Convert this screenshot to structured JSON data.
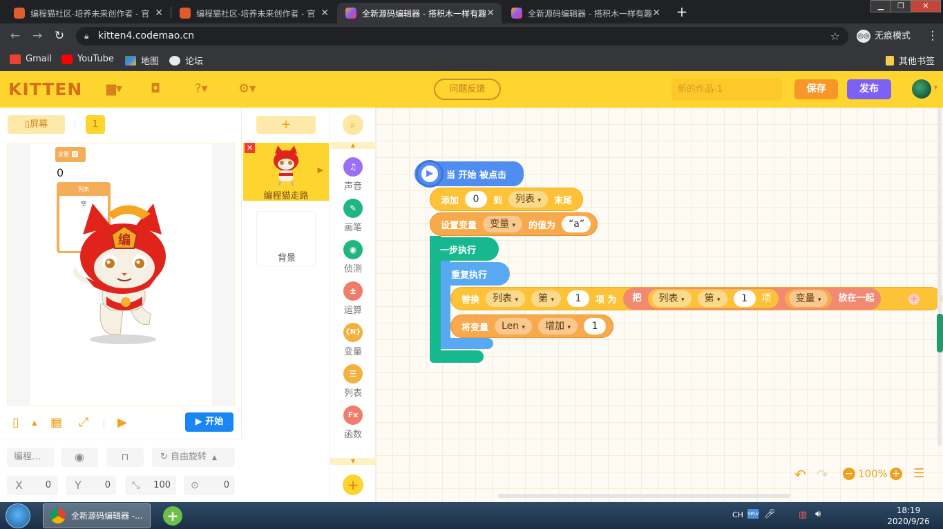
{
  "browser": {
    "tabs": [
      {
        "title": "编程猫社区-培养未来创作者 - 官",
        "active": false
      },
      {
        "title": "编程猫社区-培养未来创作者 - 官",
        "active": false
      },
      {
        "title": "全新源码编辑器 - 搭积木一样有趣",
        "active": true
      },
      {
        "title": "全新源码编辑器 - 搭积木一样有趣",
        "active": false
      }
    ],
    "tab_close": "✕",
    "new_tab": "+",
    "url": "kitten4.codemao.cn",
    "incognito_label": "无痕模式",
    "bookmarks": [
      "Gmail",
      "YouTube",
      "地图",
      "论坛"
    ],
    "other_bookmarks": "其他书签"
  },
  "app": {
    "logo": "KITTEN",
    "feedback": "问题反馈",
    "project_name_placeholder": "新的作品-1",
    "save": "保存",
    "publish": "发布"
  },
  "stage": {
    "screen_button": "屏幕",
    "screen_number": "1",
    "variable_monitor_label": "变量",
    "variable_monitor_value": "0",
    "stage_value": "0",
    "list_monitor_label": "列表",
    "list_monitor_empty": "空",
    "start_button": "开始",
    "sprite_name_short": "编程…",
    "rotation_mode": "自由旋转",
    "x_label": "X",
    "x_value": "0",
    "y_label": "Y",
    "y_value": "0",
    "size_value": "100",
    "direction_value": "0"
  },
  "sprites": {
    "add": "+",
    "selected_name": "编程猫走路",
    "background_label": "背景"
  },
  "categories": [
    {
      "label": "声音",
      "icon": "music-note-icon",
      "color": "#9b6ff5",
      "glyph": "♫"
    },
    {
      "label": "画笔",
      "icon": "pen-icon",
      "color": "#21b57f",
      "glyph": "✎"
    },
    {
      "label": "侦测",
      "icon": "sensing-icon",
      "color": "#21b57f",
      "glyph": "◉"
    },
    {
      "label": "运算",
      "icon": "operator-icon",
      "color": "#f07c6c",
      "glyph": "±"
    },
    {
      "label": "变量",
      "icon": "variable-icon",
      "color": "#f5b13d",
      "glyph": "{N}"
    },
    {
      "label": "列表",
      "icon": "list-icon",
      "color": "#f5b13d",
      "glyph": "☰"
    },
    {
      "label": "函数",
      "icon": "function-icon",
      "color": "#f07c6c",
      "glyph": "Fx"
    }
  ],
  "blocks": {
    "hat": "当 开始 被点击",
    "add_1": "添加",
    "add_value": "0",
    "add_2": "到",
    "add_list": "列表",
    "add_3": "末尾",
    "set_1": "设置变量",
    "set_var": "变量",
    "set_2": "的值为",
    "set_value": "“a”",
    "step": "一步执行",
    "repeat": "重复执行",
    "replace_1": "替换",
    "replace_list": "列表",
    "replace_di": "第",
    "replace_index": "1",
    "replace_2": "项 为",
    "join_ba": "把",
    "join_list": "列表",
    "join_di": "第",
    "join_index": "1",
    "join_xiang": "项",
    "join_var": "变量",
    "join_end": "放在一起",
    "change_1": "将变量",
    "change_var": "Len",
    "change_2": "增加",
    "change_value": "1"
  },
  "zoom": "100%",
  "taskbar": {
    "window_title": "全新源码编辑器 -...",
    "lang": "CH",
    "time": "18:19",
    "date": "2020/9/26"
  }
}
